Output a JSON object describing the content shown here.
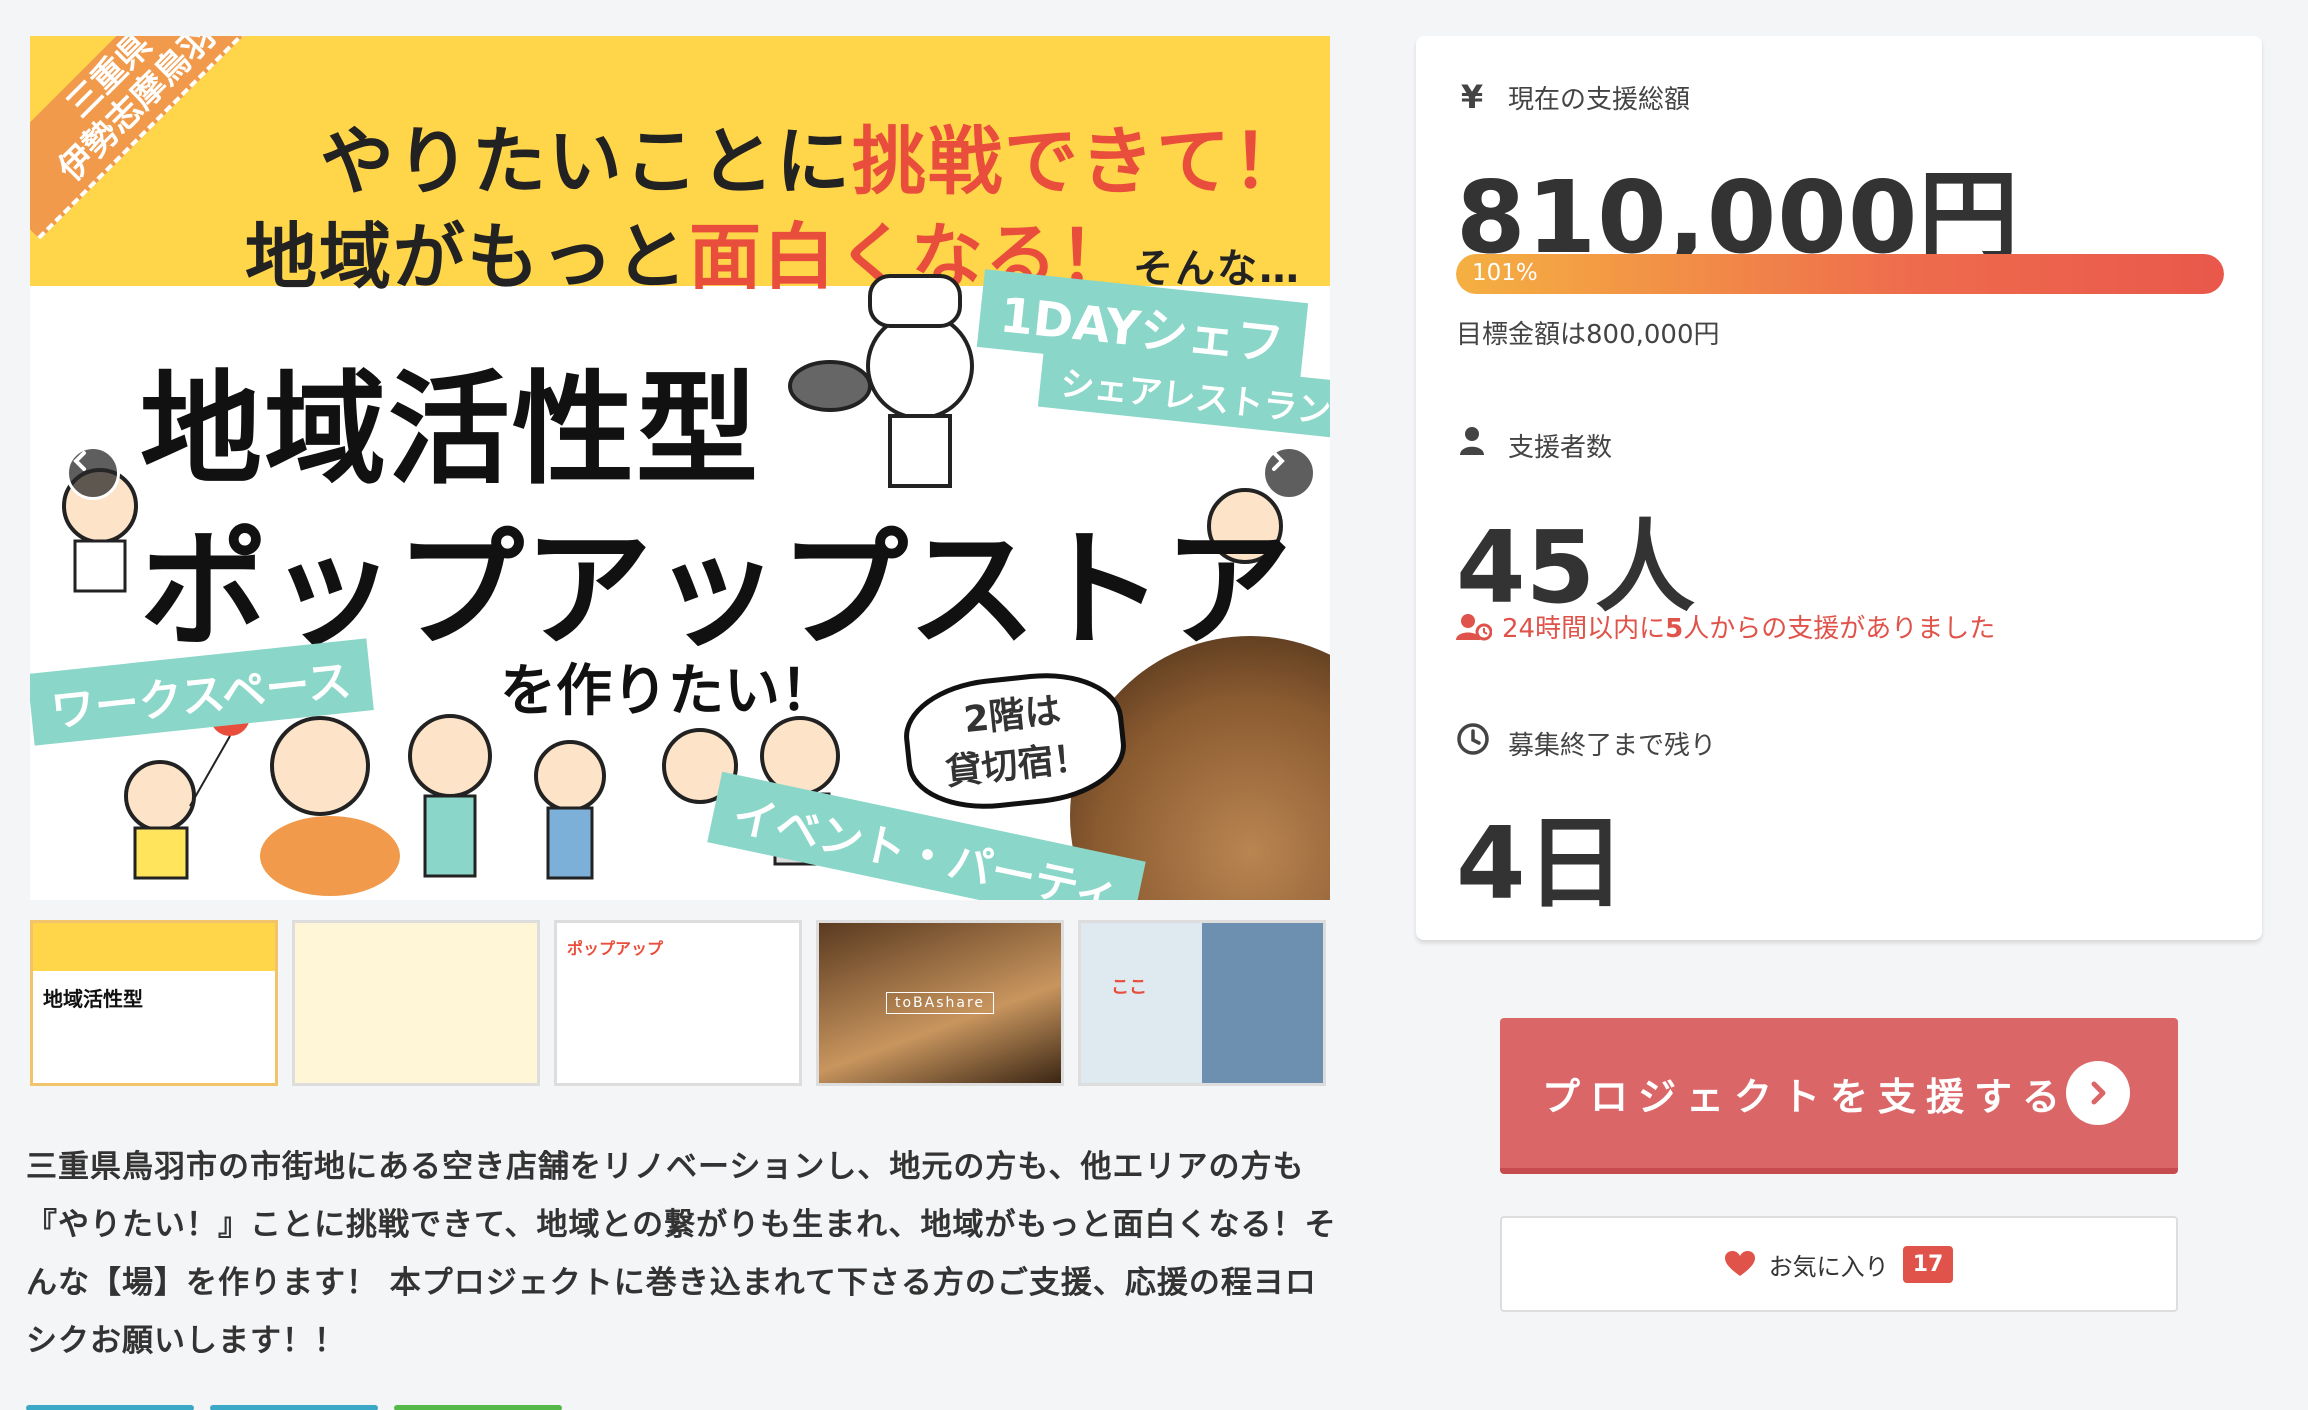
{
  "hero": {
    "corner_text": "三重県\n伊勢志摩鳥羽",
    "line1_a": "やりたいことに",
    "line1_b": "挑戦できて！",
    "line2_a": "地域がもっと",
    "line2_b": "面白くなる！",
    "line2_c": "そんな…",
    "tag_1day": "1DAYシェフ",
    "tag_share": "シェアレストラン",
    "title1": "地域活性型",
    "title2": "ポップアップストア",
    "subtitle": "を作りたい！",
    "tag_work": "ワークスペース",
    "bubble": "2階は\n貸切宿！",
    "tag_event": "イベント・パーティ"
  },
  "thumbs": [
    {
      "label": "地域活性型"
    },
    {
      "label": ""
    },
    {
      "label": "ポップアップ"
    },
    {
      "label": "toBAshare"
    },
    {
      "label": "ここ"
    }
  ],
  "description": "三重県鳥羽市の市街地にある空き店舗をリノベーションし、地元の方も、他エリアの方も『やりたい！』ことに挑戦できて、地域との繋がりも生まれ、地域がもっと面白くなる！そんな【場】を作ります！ 本プロジェクトに巻き込まれて下さる方のご支援、応援の程ヨロシクお願いします！！",
  "stats": {
    "amount_icon": "¥",
    "amount_label": "現在の支援総額",
    "amount_value": "810,000円",
    "progress_label": "101%",
    "progress_fraction": 1.0,
    "goal_text": "目標金額は800,000円",
    "backers_label": "支援者数",
    "backers_value": "45人",
    "recent_prefix": "24時間以内に",
    "recent_count": "5",
    "recent_suffix": "人からの支援がありました",
    "remain_label": "募集終了まで残り",
    "remain_value": "4日"
  },
  "actions": {
    "support_label": "プロジェクトを支援する",
    "favorite_label": "お気に入り",
    "favorite_count": "17"
  },
  "colors": {
    "accent_red": "#db6668",
    "alert_red": "#e0534a",
    "hero_yellow": "#ffd54a",
    "tag_teal": "#8ad6c9"
  }
}
